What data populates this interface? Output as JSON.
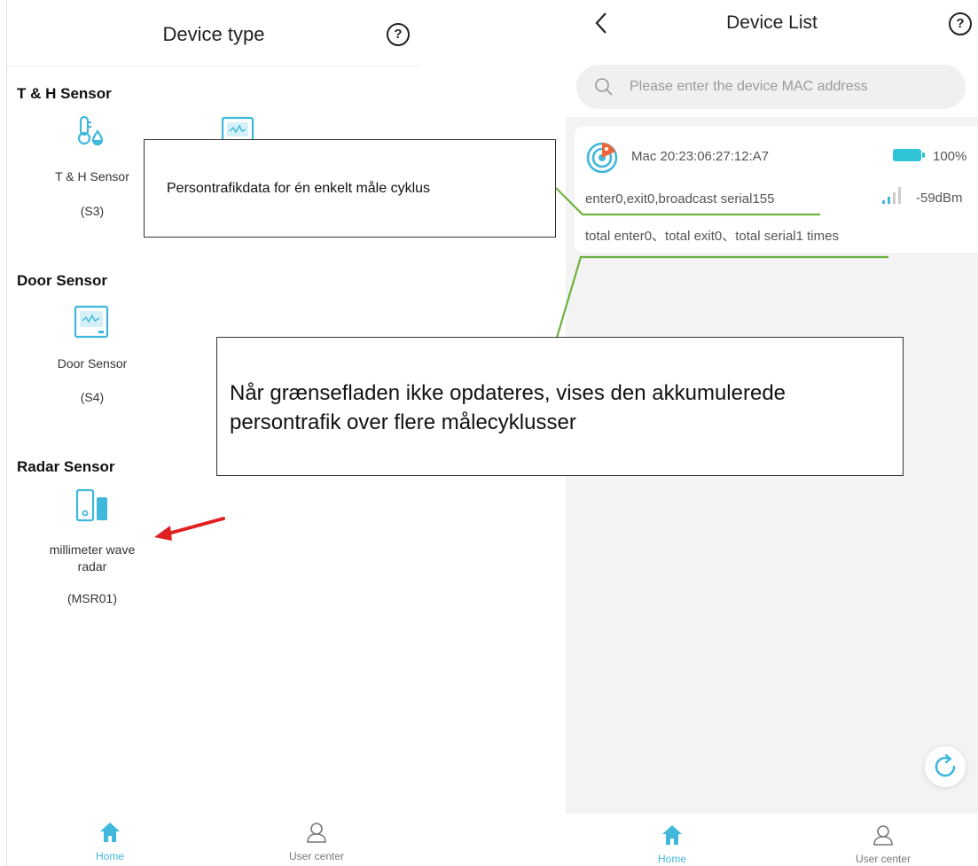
{
  "left_panel": {
    "title": "Device type",
    "help_icon": "?",
    "sections": [
      {
        "title": "T & H Sensor",
        "devices": [
          {
            "label": "T & H Sensor",
            "model": "(S3)",
            "icon": "thermometer-droplet-icon"
          }
        ]
      },
      {
        "title": "Door Sensor",
        "devices": [
          {
            "label": "Door Sensor",
            "model": "(S4)",
            "icon": "monitor-screen-icon"
          }
        ]
      },
      {
        "title": "Radar Sensor",
        "devices": [
          {
            "label_line1": "millimeter wave",
            "label_line2": "radar",
            "model": "(MSR01)",
            "icon": "radar-device-icon"
          }
        ]
      }
    ],
    "nav": {
      "home": "Home",
      "user_center": "User center"
    }
  },
  "right_panel": {
    "title": "Device List",
    "help_icon": "?",
    "back_icon": "chevron-left-icon",
    "search": {
      "placeholder": "Please enter the device MAC address"
    },
    "device_card": {
      "mac": "Mac 20:23:06:27:12:A7",
      "battery": "100%",
      "status_line": "enter0,exit0,broadcast serial155",
      "signal": "-59dBm",
      "total_line": "total enter0、total exit0、total serial1 times"
    },
    "nav": {
      "home": "Home",
      "user_center": "User center"
    }
  },
  "annotations": {
    "callout_1": "Persontrafikdata for én enkelt måle cyklus",
    "callout_2_line1": "Når grænsefladen ikke opdateres, vises den akkumulerede",
    "callout_2_line2": "persontrafik over flere målecyklusser"
  },
  "colors": {
    "accent": "#3fb8dc",
    "accent_orange": "#f0673a",
    "annotation_line": "#6db33f",
    "arrow": "#e02020",
    "battery": "#2fc4d8"
  }
}
